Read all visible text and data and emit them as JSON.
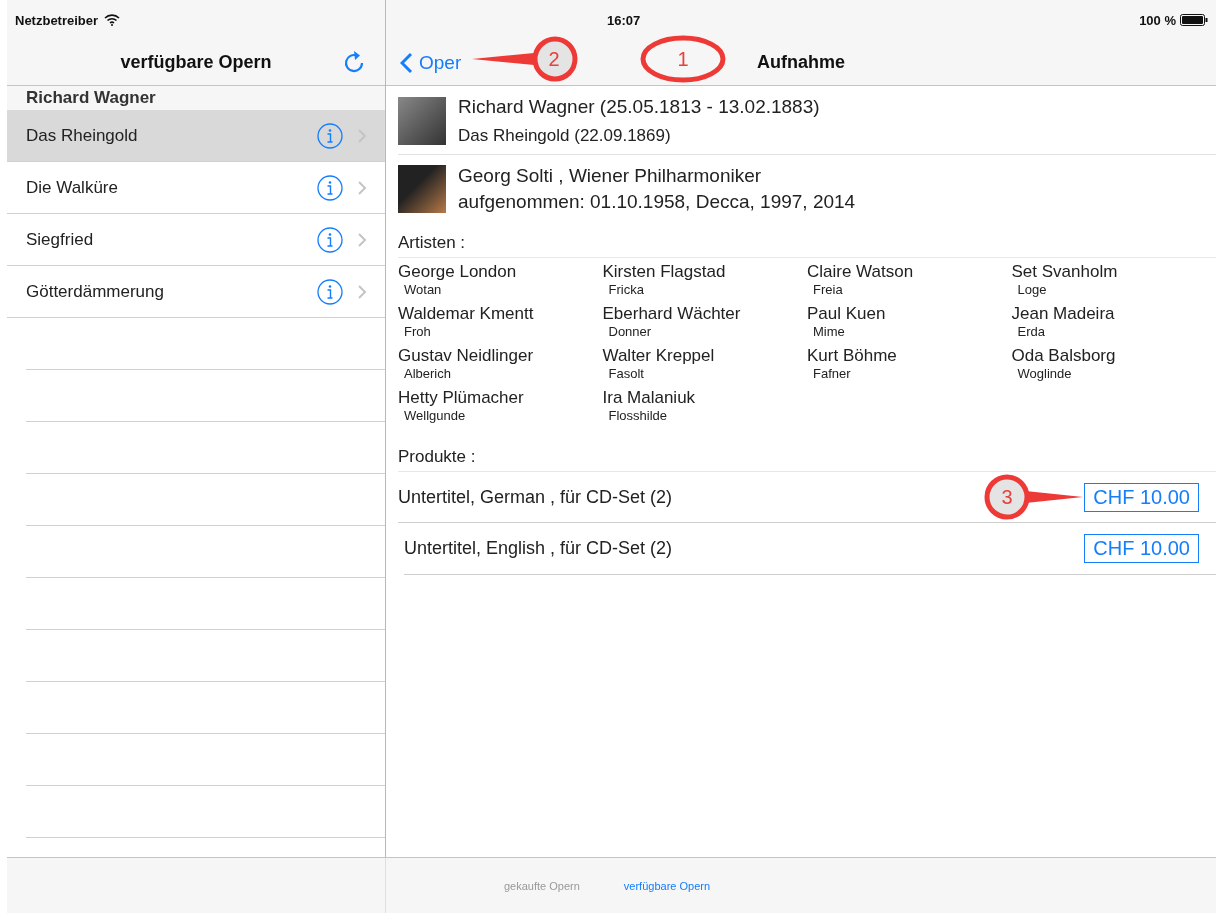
{
  "status_bar": {
    "carrier": "Netzbetreiber",
    "time": "16:07",
    "battery": "100 %"
  },
  "sidebar": {
    "title": "verfügbare Opern",
    "section": "Richard Wagner",
    "items": [
      {
        "label": "Das Rheingold",
        "selected": true
      },
      {
        "label": "Die Walküre",
        "selected": false
      },
      {
        "label": "Siegfried",
        "selected": false
      },
      {
        "label": "Götterdämmerung",
        "selected": false
      }
    ]
  },
  "detail": {
    "back": "Oper",
    "title": "Aufnahme",
    "composer": {
      "name": "Richard Wagner (25.05.1813 - 13.02.1883)",
      "work": "Das Rheingold (22.09.1869)"
    },
    "recording": {
      "performers": "Georg Solti , Wiener Philharmoniker",
      "recorded": "aufgenommen: 01.10.1958, Decca, 1997, 2014"
    },
    "artists_heading": "Artisten :",
    "artists": [
      {
        "name": "George London",
        "role": "Wotan"
      },
      {
        "name": "Kirsten Flagstad",
        "role": "Fricka"
      },
      {
        "name": "Claire Watson",
        "role": "Freia"
      },
      {
        "name": "Set Svanholm",
        "role": "Loge"
      },
      {
        "name": "Waldemar Kmentt",
        "role": "Froh"
      },
      {
        "name": "Eberhard Wächter",
        "role": "Donner"
      },
      {
        "name": "Paul Kuen",
        "role": "Mime"
      },
      {
        "name": "Jean Madeira",
        "role": "Erda"
      },
      {
        "name": "Gustav Neidlinger",
        "role": "Alberich"
      },
      {
        "name": "Walter Kreppel",
        "role": "Fasolt"
      },
      {
        "name": "Kurt Böhme",
        "role": "Fafner"
      },
      {
        "name": "Oda Balsborg",
        "role": "Woglinde"
      },
      {
        "name": "Hetty Plümacher",
        "role": "Wellgunde"
      },
      {
        "name": "Ira Malaniuk",
        "role": "Flosshilde"
      }
    ],
    "products_heading": "Produkte :",
    "products": [
      {
        "label": "Untertitel, German , für CD-Set (2)",
        "price": "CHF 10.00"
      },
      {
        "label": "Untertitel, English , für CD-Set (2)",
        "price": "CHF 10.00"
      }
    ]
  },
  "tab_bar": [
    {
      "label": "gekaufte Opern",
      "selected": false
    },
    {
      "label": "verfügbare Opern",
      "selected": true
    }
  ],
  "annotations": [
    {
      "label": "1",
      "kind": "ellipse"
    },
    {
      "label": "2",
      "kind": "pointer"
    },
    {
      "label": "3",
      "kind": "pointer"
    }
  ]
}
